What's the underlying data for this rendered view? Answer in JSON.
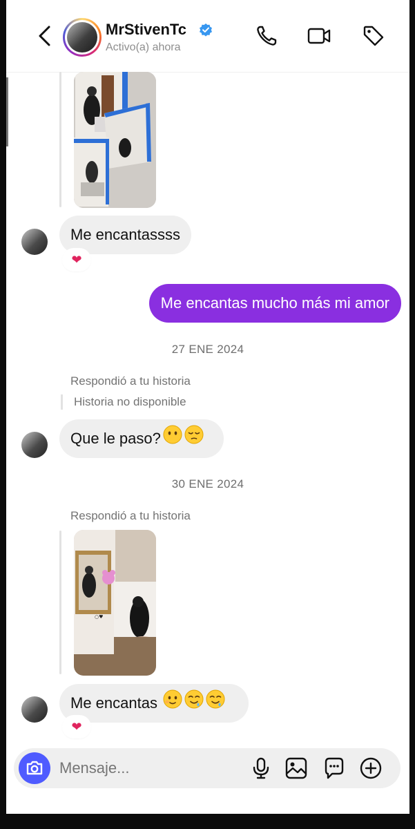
{
  "header": {
    "username": "MrStivenTc",
    "status": "Activo(a) ahora",
    "icons": [
      "back-arrow-icon",
      "verified-badge-icon",
      "phone-icon",
      "video-camera-icon",
      "tag-icon"
    ]
  },
  "messages": {
    "m1_text": "Me encantassss",
    "m1_reaction": "❤",
    "m2_text": "Me encantas mucho más mi amor",
    "date1": "27 ENE 2024",
    "reply1_label": "Respondió a tu historia",
    "reply1_story": "Historia no disponible",
    "m3_text": "Que le paso?",
    "date2": "30 ENE 2024",
    "reply2_label": "Respondió a tu historia",
    "m4_text": "Me encantas",
    "m4_reaction": "❤"
  },
  "composer": {
    "placeholder": "Mensaje...",
    "icons": [
      "camera-icon",
      "microphone-icon",
      "gallery-icon",
      "sticker-icon",
      "add-icon"
    ]
  },
  "colors": {
    "outgoing_bubble": "#8a2fe0",
    "incoming_bubble": "#efefef",
    "camera_button": "#4f5bff",
    "verified": "#3897f0",
    "reaction": "#e0245e"
  }
}
